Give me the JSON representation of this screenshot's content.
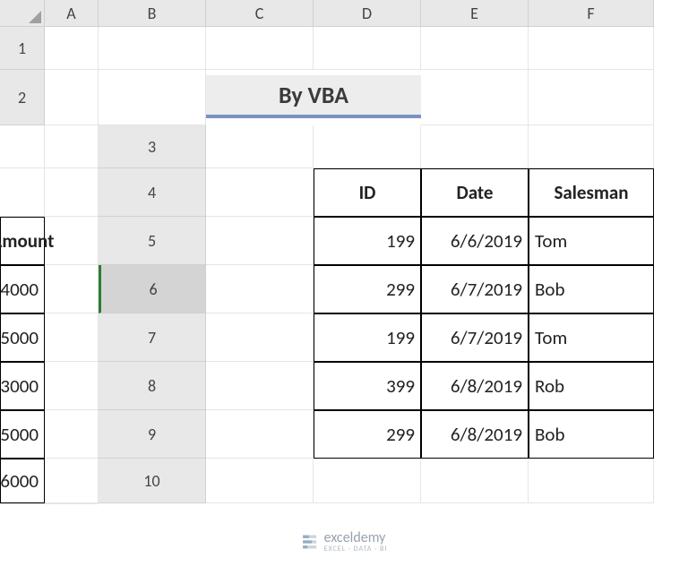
{
  "columns": [
    "A",
    "B",
    "C",
    "D",
    "E",
    "F"
  ],
  "rows": [
    "1",
    "2",
    "3",
    "4",
    "5",
    "6",
    "7",
    "8",
    "9",
    "10"
  ],
  "title": "By VBA",
  "selected_row": "6",
  "table": {
    "headers": [
      "ID",
      "Date",
      "Salesman",
      "Amount"
    ],
    "rows": [
      {
        "id": "199",
        "date": "6/6/2019",
        "salesman": "Tom",
        "amount": "4000"
      },
      {
        "id": "299",
        "date": "6/7/2019",
        "salesman": "Bob",
        "amount": "5000"
      },
      {
        "id": "199",
        "date": "6/7/2019",
        "salesman": "Tom",
        "amount": "3000"
      },
      {
        "id": "399",
        "date": "6/8/2019",
        "salesman": "Rob",
        "amount": "5000"
      },
      {
        "id": "299",
        "date": "6/8/2019",
        "salesman": "Bob",
        "amount": "6000"
      }
    ]
  },
  "watermark": {
    "brand": "exceldemy",
    "tagline": "EXCEL · DATA · BI"
  }
}
